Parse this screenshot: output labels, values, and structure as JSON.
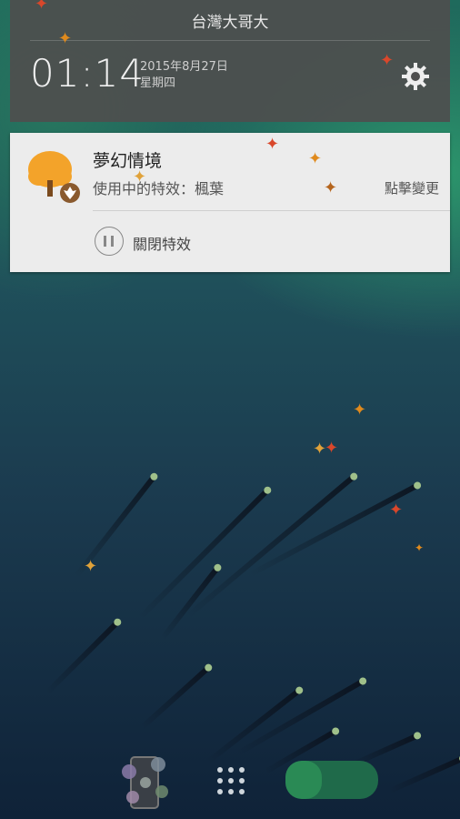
{
  "status": {
    "carrier": "台灣大哥大",
    "time": "01:14",
    "date": "2015年8月27日",
    "weekday": "星期四"
  },
  "notification": {
    "title": "夢幻情境",
    "subtitle": "使用中的特效：楓葉",
    "action_link": "點擊變更",
    "close_label": "關閉特效"
  },
  "icons": {
    "settings": "gear-icon",
    "tree": "tree-icon",
    "pause": "pause-icon",
    "apps": "app-drawer-icon"
  },
  "colors": {
    "tree_orange": "#f3a32a",
    "tree_trunk": "#7a4a1e",
    "leaf_red": "#d9472b",
    "leaf_orange": "#e08a1d"
  }
}
